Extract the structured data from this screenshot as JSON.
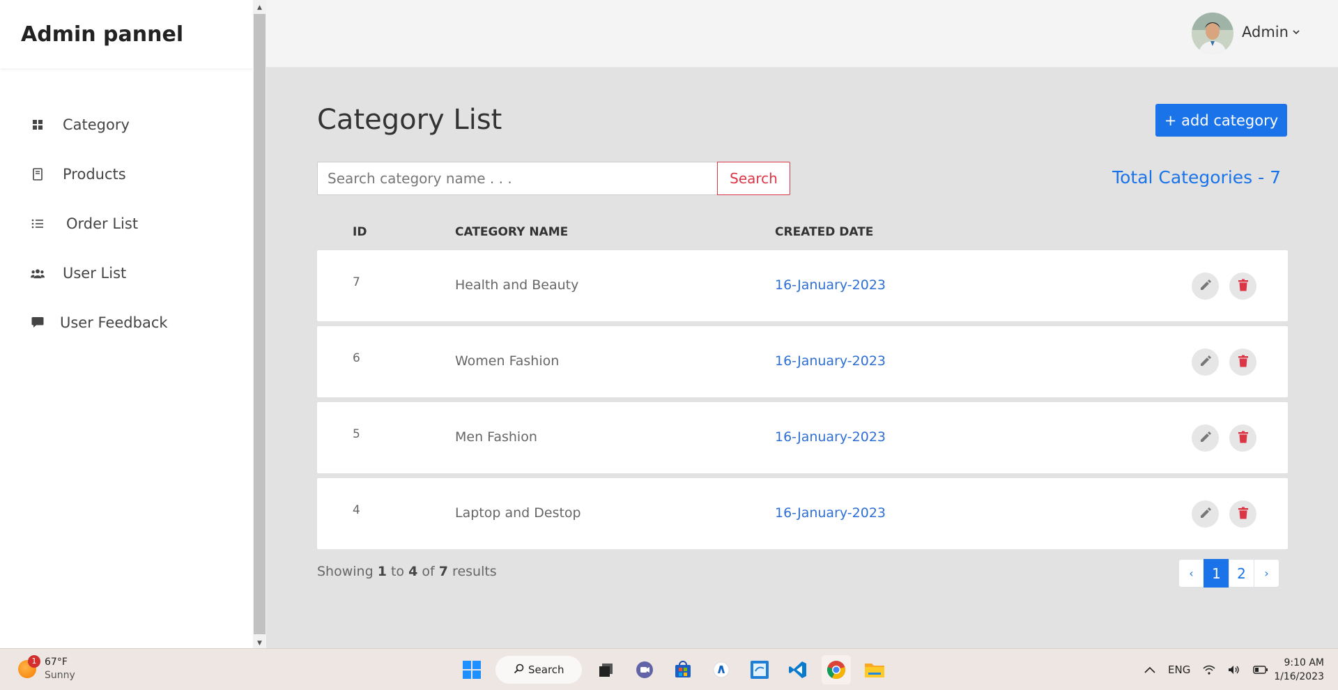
{
  "sidebar": {
    "brand": "Admin pannel",
    "items": [
      {
        "label": "Category",
        "icon": "grid-icon"
      },
      {
        "label": "Products",
        "icon": "book-icon"
      },
      {
        "label": "Order List",
        "icon": "list-icon"
      },
      {
        "label": "User List",
        "icon": "users-icon"
      },
      {
        "label": "User Feedback",
        "icon": "comment-icon"
      }
    ]
  },
  "header": {
    "user_name": "Admin",
    "user_menu_icon": "chevron-down-icon"
  },
  "main": {
    "title": "Category List",
    "add_button": "+ add category",
    "search": {
      "placeholder": "Search category name . . .",
      "value": "",
      "button": "Search"
    },
    "total_label": "Total Categories - 7",
    "columns": {
      "id": "ID",
      "name": "CATEGORY NAME",
      "date": "CREATED DATE"
    },
    "rows": [
      {
        "id": "7",
        "name": "Health and Beauty",
        "date": "16-January-2023"
      },
      {
        "id": "6",
        "name": "Women Fashion",
        "date": "16-January-2023"
      },
      {
        "id": "5",
        "name": "Men Fashion",
        "date": "16-January-2023"
      },
      {
        "id": "4",
        "name": "Laptop and Destop",
        "date": "16-January-2023"
      }
    ],
    "showing": {
      "prefix": "Showing",
      "from": "1",
      "to_word": "to",
      "to": "4",
      "of_word": "of",
      "total": "7",
      "suffix": "results"
    },
    "pagination": {
      "prev": "‹",
      "pages": [
        "1",
        "2"
      ],
      "active": "1",
      "next": "›"
    }
  },
  "taskbar": {
    "weather": {
      "badge": "1",
      "temp": "67°F",
      "condition": "Sunny"
    },
    "search_label": "Search",
    "language": "ENG",
    "time": "9:10 AM",
    "date": "1/16/2023"
  },
  "colors": {
    "accent": "#1a73e8",
    "danger": "#dc3545",
    "date_link": "#2d6fd6"
  }
}
